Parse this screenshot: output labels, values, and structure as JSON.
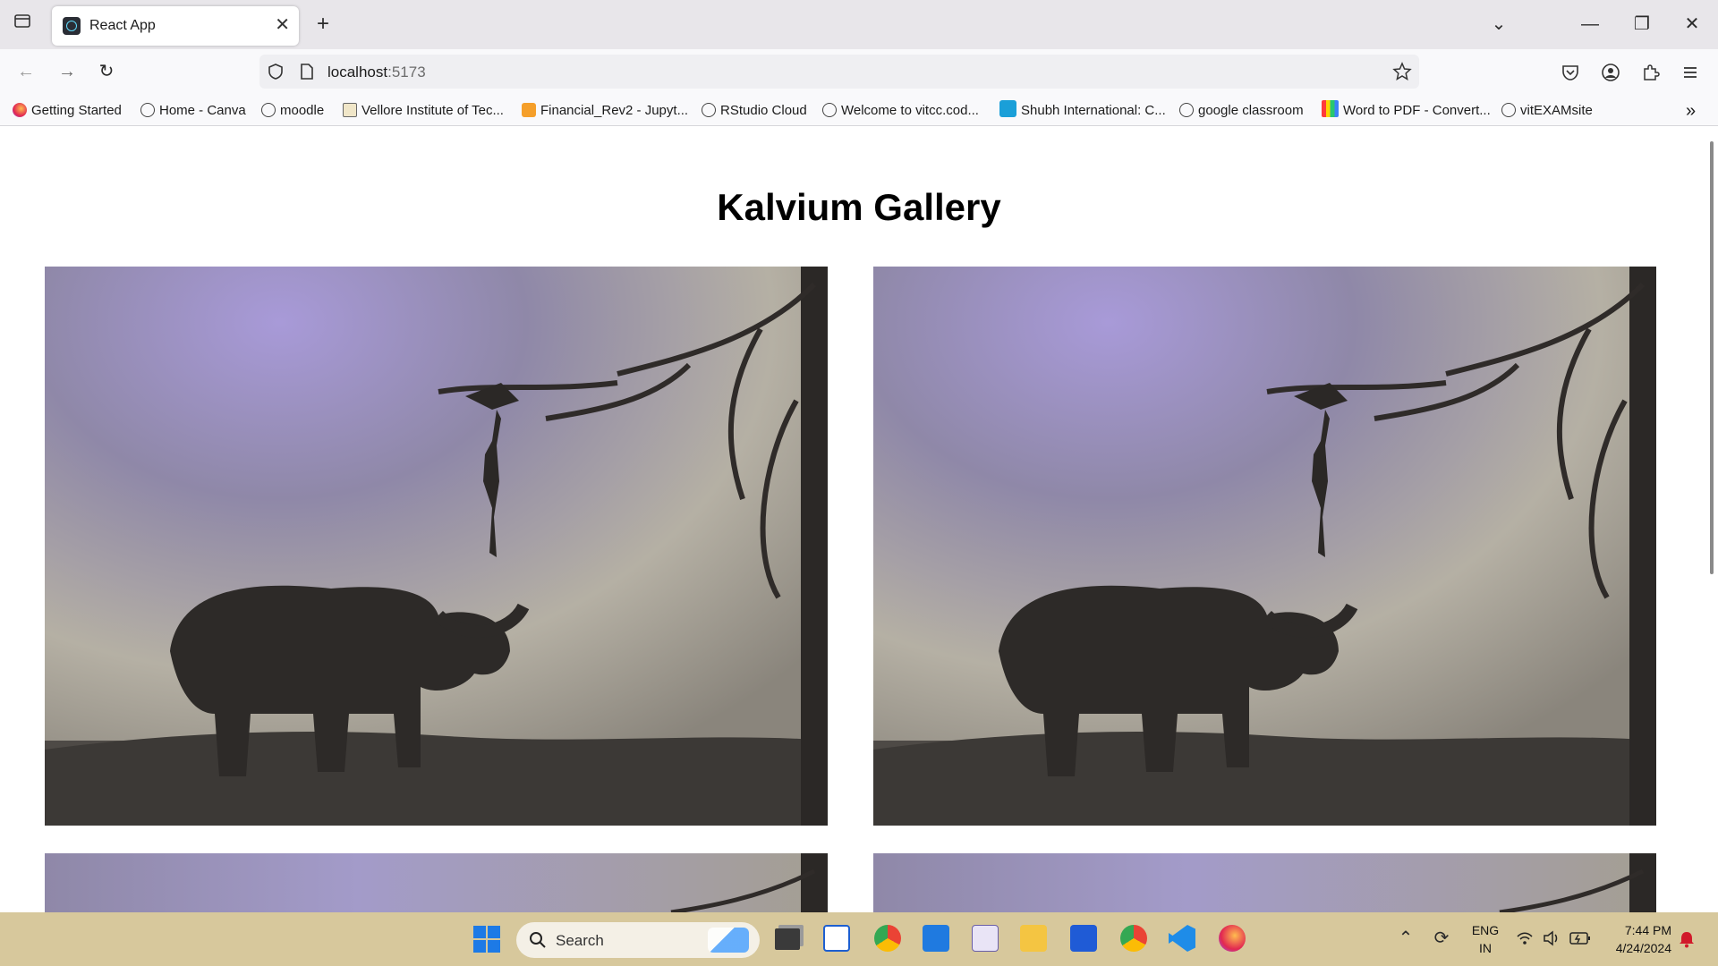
{
  "browser": {
    "tab_title": "React App",
    "url_host": "localhost",
    "url_port": ":5173",
    "bookmarks": [
      "Getting Started",
      "Home - Canva",
      "moodle",
      "Vellore Institute of Tec...",
      "Financial_Rev2 - Jupyt...",
      "RStudio Cloud",
      "Welcome to vitcc.cod...",
      "Shubh International: C...",
      "google classroom",
      "Word to PDF - Convert...",
      "vitEXAMsite"
    ]
  },
  "page": {
    "heading": "Kalvium Gallery",
    "gallery_alt": "Charcoal drawing of a person standing on an elephant reaching toward a tree branch"
  },
  "taskbar": {
    "search_placeholder": "Search",
    "lang_line1": "ENG",
    "lang_line2": "IN",
    "time": "7:44 PM",
    "date": "4/24/2024"
  },
  "colors": {
    "taskbar_bg": "#d7c89c",
    "tabbar_bg": "#e8e6ea",
    "toolbar_bg": "#f9f9fb"
  }
}
